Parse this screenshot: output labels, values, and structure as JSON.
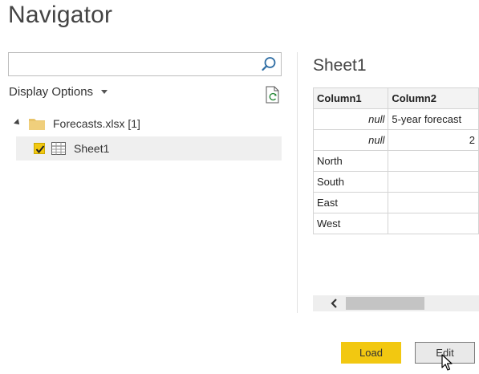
{
  "window": {
    "title": "Navigator"
  },
  "search": {
    "value": "",
    "placeholder": ""
  },
  "options": {
    "display_label": "Display Options"
  },
  "tree": {
    "file_label": "Forecasts.xlsx [1]",
    "sheet_label": "Sheet1",
    "sheet_checked": true
  },
  "preview": {
    "title": "Sheet1",
    "columns": [
      "Column1",
      "Column2"
    ],
    "rows": [
      [
        "null",
        "5-year forecast"
      ],
      [
        "null",
        "2"
      ],
      [
        "North",
        ""
      ],
      [
        "South",
        ""
      ],
      [
        "East",
        ""
      ],
      [
        "West",
        ""
      ]
    ]
  },
  "buttons": {
    "load": "Load",
    "edit": "Edit"
  },
  "colors": {
    "accent": "#f2c811",
    "folder": "#e8c46a"
  },
  "icons": [
    "search-icon",
    "refresh-icon",
    "folder-icon",
    "table-icon",
    "checkmark-icon",
    "chevron-left-icon",
    "mouse-cursor-icon"
  ]
}
